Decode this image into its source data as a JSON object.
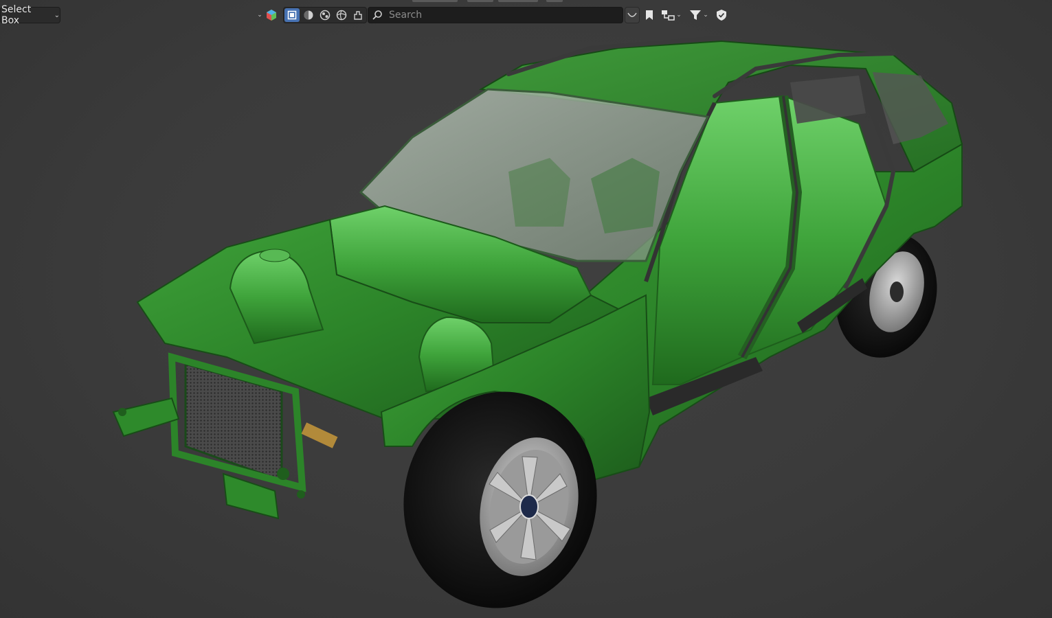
{
  "header": {
    "select_mode": {
      "label": "Select Box"
    },
    "search": {
      "placeholder": "Search",
      "value": ""
    },
    "viewport_shading_modes": [
      "wireframe-icon",
      "solid-icon",
      "material-preview-icon",
      "rendered-icon",
      "overlay-icon"
    ],
    "active_shading_mode": "wireframe-icon",
    "tools": [
      "object-type-visibility-icon",
      "bookmark-icon",
      "hierarchy-icon",
      "filter-icon",
      "shield-icon"
    ]
  },
  "viewport": {
    "subject": "green-station-wagon-body-in-white",
    "background_color": "#3b3b3b",
    "body_color": "#2e8a2b",
    "glass_color": "#9aa89a",
    "tire_color": "#121212"
  }
}
